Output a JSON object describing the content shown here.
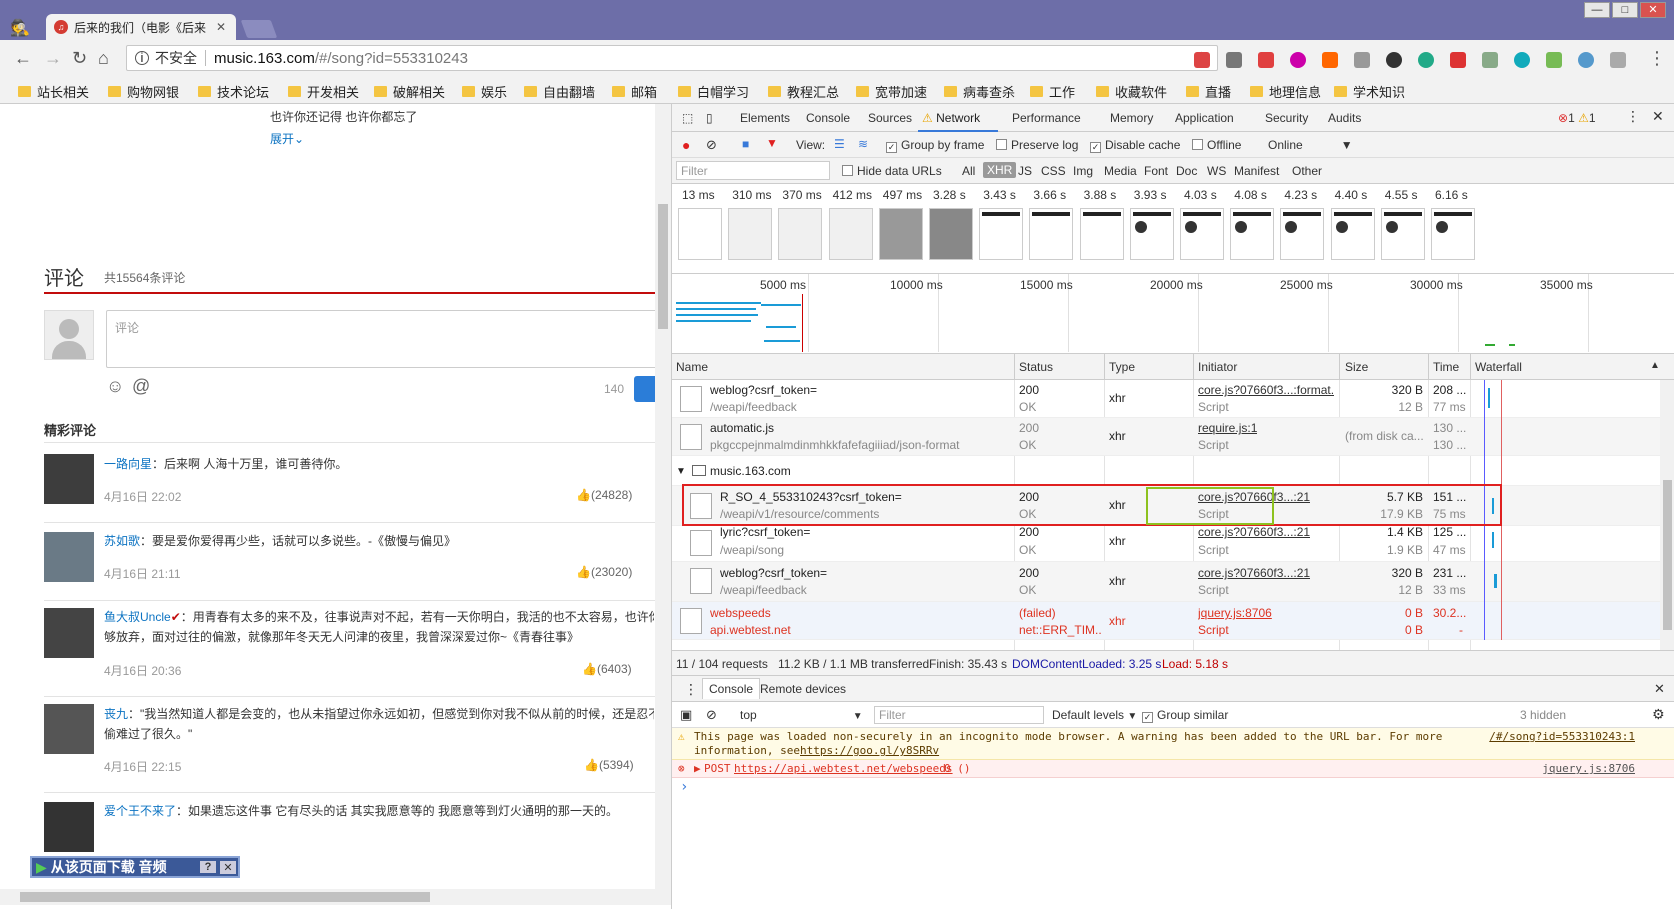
{
  "browser": {
    "tab_title": "后来的我们（电影《后来",
    "address": {
      "insecure_label": "不安全",
      "host": "music.163.com",
      "path": "/#/song?id=553310243"
    },
    "bookmarks": [
      "站长相关",
      "购物网银",
      "技术论坛",
      "开发相关",
      "破解相关",
      "娱乐",
      "自由翻墙",
      "邮箱",
      "白帽学习",
      "教程汇总",
      "宽带加速",
      "病毒查杀",
      "工作",
      "收藏软件",
      "直播",
      "地理信息",
      "学术知识"
    ]
  },
  "page": {
    "lyric_line": "也许你还记得 也许你都忘了",
    "expand_label": "展开",
    "comments_title": "评论",
    "comments_count": "共15564条评论",
    "comment_placeholder": "评论",
    "char_count": "140",
    "hot_title": "精彩评论",
    "comments": [
      {
        "user": "一路向星",
        "text": "：后来啊 人海十万里，谁可善待你。",
        "date": "4月16日 22:02",
        "likes": "(24828)"
      },
      {
        "user": "苏如歌",
        "text": "：要是爱你爱得再少些，话就可以多说些。-《傲慢与偏见》",
        "date": "4月16日 21:11",
        "likes": "(23020)"
      },
      {
        "user": "鱼大叔Uncle",
        "text": "：用青春有太多的来不及，往事说声对不起，若有一天你明白，我活的也不太容易，也许你",
        "text2": "够放弃，面对过往的偏激，就像那年冬天无人问津的夜里，我曾深深爱过你~《青春往事》",
        "date": "4月16日 20:36",
        "likes": "(6403)"
      },
      {
        "user": "丧九",
        "text": "：\"我当然知道人都是会变的，也从未指望过你永远如初，但感觉到你对我不似从前的时候，还是忍不",
        "text2": "偷难过了很久。\"",
        "date": "4月16日 22:15",
        "likes": "(5394)"
      },
      {
        "user": "爱个王不来了",
        "text": "：如果遗忘这件事 它有尽头的话 其实我愿意等的 我愿意等到灯火通明的那一天的。"
      }
    ],
    "download_bar": "从该页面下载 音频"
  },
  "devtools": {
    "tabs": [
      "Elements",
      "Console",
      "Sources",
      "Network",
      "Performance",
      "Memory",
      "Application",
      "Security",
      "Audits"
    ],
    "active_tab": "Network",
    "badges": {
      "errors": "1",
      "warnings": "1"
    },
    "net_toolbar": {
      "view": "View:",
      "group_by_frame": "Group by frame",
      "preserve_log": "Preserve log",
      "disable_cache": "Disable cache",
      "offline": "Offline",
      "online": "Online"
    },
    "filter": {
      "placeholder": "Filter",
      "hide_data_urls": "Hide data URLs",
      "types": [
        "All",
        "XHR",
        "JS",
        "CSS",
        "Img",
        "Media",
        "Font",
        "Doc",
        "WS",
        "Manifest",
        "Other"
      ]
    },
    "filmstrip_times": [
      "13 ms",
      "310 ms",
      "370 ms",
      "412 ms",
      "497 ms",
      "3.28 s",
      "3.43 s",
      "3.66 s",
      "3.88 s",
      "3.93 s",
      "4.03 s",
      "4.08 s",
      "4.23 s",
      "4.40 s",
      "4.55 s",
      "6.16 s"
    ],
    "overview_labels": [
      "5000 ms",
      "10000 ms",
      "15000 ms",
      "20000 ms",
      "25000 ms",
      "30000 ms",
      "35000 ms"
    ],
    "columns": [
      "Name",
      "Status",
      "Type",
      "Initiator",
      "Size",
      "Time",
      "Waterfall"
    ],
    "rows": [
      {
        "name": "weblog?csrf_token=",
        "path": "/weapi/feedback",
        "status": "200",
        "status_text": "OK",
        "type": "xhr",
        "initiator": "core.js?07660f3...:format...",
        "initiator_type": "Script",
        "size": "320 B",
        "size2": "12 B",
        "time": "208 ...",
        "time2": "77 ms"
      },
      {
        "name": "automatic.js",
        "path": "pkgccpejnmalmdinmhkkfafefagiiiad/json-format",
        "status": "200",
        "status_text": "OK",
        "type": "xhr",
        "initiator": "require.js:1",
        "initiator_type": "Script",
        "size": "(from disk ca...",
        "size2": "",
        "time": "130 ...",
        "time2": "130 ..."
      },
      {
        "group": "music.163.com"
      },
      {
        "name": "R_SO_4_553310243?csrf_token=",
        "path": "/weapi/v1/resource/comments",
        "status": "200",
        "status_text": "OK",
        "type": "xhr",
        "initiator": "core.js?07660f3...:21",
        "initiator_type": "Script",
        "size": "5.7 KB",
        "size2": "17.9 KB",
        "time": "151 ...",
        "time2": "75 ms"
      },
      {
        "name": "lyric?csrf_token=",
        "path": "/weapi/song",
        "status": "200",
        "status_text": "OK",
        "type": "xhr",
        "initiator": "core.js?07660f3...:21",
        "initiator_type": "Script",
        "size": "1.4 KB",
        "size2": "1.9 KB",
        "time": "125 ...",
        "time2": "47 ms"
      },
      {
        "name": "weblog?csrf_token=",
        "path": "/weapi/feedback",
        "status": "200",
        "status_text": "OK",
        "type": "xhr",
        "initiator": "core.js?07660f3...:21",
        "initiator_type": "Script",
        "size": "320 B",
        "size2": "12 B",
        "time": "231 ...",
        "time2": "33 ms"
      },
      {
        "name": "webspeeds",
        "path": "api.webtest.net",
        "status": "(failed)",
        "status_text": "net::ERR_TIM...",
        "type": "xhr",
        "initiator": "jquery.js:8706",
        "initiator_type": "Script",
        "size": "0 B",
        "size2": "0 B",
        "time": "30.2...",
        "time2": "-"
      }
    ],
    "summary": {
      "requests": "11 / 104 requests",
      "transferred": "11.2 KB / 1.1 MB transferred",
      "finish": "Finish: 35.43 s",
      "dcl": "DOMContentLoaded: 3.25 s",
      "load": "Load: 5.18 s"
    },
    "drawer": {
      "tabs": [
        "Console",
        "Remote devices"
      ],
      "context": "top",
      "filter_placeholder": "Filter",
      "levels": "Default levels",
      "group_similar": "Group similar",
      "hidden": "3 hidden",
      "warning_text": "This page was loaded non-securely in an incognito mode browser. A warning has been added to the URL bar. For more",
      "warning_text2": "information, see",
      "warning_link": "https://goo.gl/y8SRRv",
      "warning_src": "/#/song?id=553310243:1",
      "error_method": "POST",
      "error_url": "https://api.webtest.net/webspeeds",
      "error_status": "0 ()",
      "error_src": "jquery.js:8706",
      "prompt": "›"
    }
  },
  "colors": {
    "title_bar": "#6d6ea8",
    "accent_red": "#c20c0c",
    "link_blue": "#0c73c2",
    "highlight_red": "#e02020",
    "highlight_green": "#8ec21f",
    "dcl_blue": "#1a1aa6",
    "load_red": "#c00000"
  }
}
